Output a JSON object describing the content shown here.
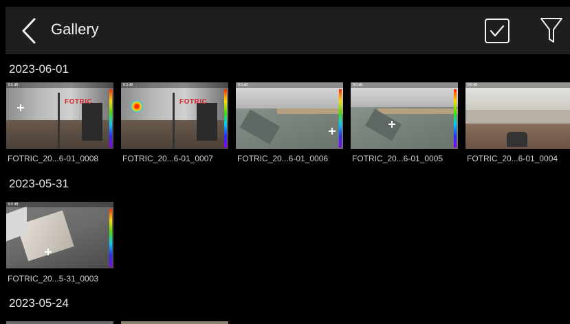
{
  "appbar": {
    "title": "Gallery",
    "back_icon": "chevron-left-icon",
    "select_icon": "checkbox-checked-icon",
    "filter_icon": "filter-icon"
  },
  "groups": [
    {
      "date": "2023-06-01",
      "items": [
        {
          "name": "FOTRIC_20...6-01_0008"
        },
        {
          "name": "FOTRIC_20...6-01_0007"
        },
        {
          "name": "FOTRIC_20...6-01_0006"
        },
        {
          "name": "FOTRIC_20...6-01_0005"
        },
        {
          "name": "FOTRIC_20...6-01_0004"
        }
      ]
    },
    {
      "date": "2023-05-31",
      "items": [
        {
          "name": "FOTRIC_20...5-31_0003"
        }
      ]
    },
    {
      "date": "2023-05-24",
      "items": []
    }
  ],
  "thumb_overlay": {
    "scale_text": "8.0 dB",
    "brand_text": "FOTRIC"
  },
  "colors": {
    "background": "#000000",
    "appbar": "#1e1e1e",
    "text": "#e6e6e6",
    "brand_red": "#d8242c"
  }
}
